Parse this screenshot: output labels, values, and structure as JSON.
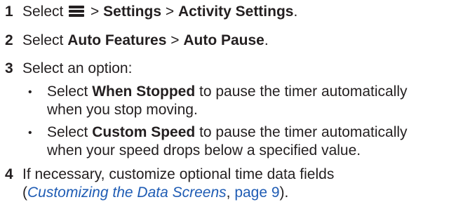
{
  "steps": [
    {
      "number": "1",
      "prefix": "Select",
      "icon": "menu-icon",
      "sep1": " > ",
      "item1": "Settings",
      "sep2": " > ",
      "item2": "Activity Settings",
      "end": "."
    },
    {
      "number": "2",
      "prefix": "Select ",
      "item1": "Auto Features",
      "sep1": " > ",
      "item2": "Auto Pause",
      "end": "."
    },
    {
      "number": "3",
      "text": "Select an option:",
      "bullets": [
        {
          "prefix": "Select ",
          "bold": "When Stopped",
          "line1_rest": " to pause the timer automatically",
          "line2": "when you stop moving."
        },
        {
          "prefix": "Select ",
          "bold": "Custom Speed",
          "line1_rest": " to pause the timer automatically",
          "line2": "when your speed drops below a specified value."
        }
      ]
    },
    {
      "number": "4",
      "line1": "If necessary, customize optional time data fields",
      "line2_open": "(",
      "link_text": "Customizing the Data Screens",
      "link_sep": ", ",
      "link_page": "page 9",
      "line2_close": ")."
    }
  ],
  "colors": {
    "text": "#231f20",
    "link": "#1f5cb4"
  }
}
